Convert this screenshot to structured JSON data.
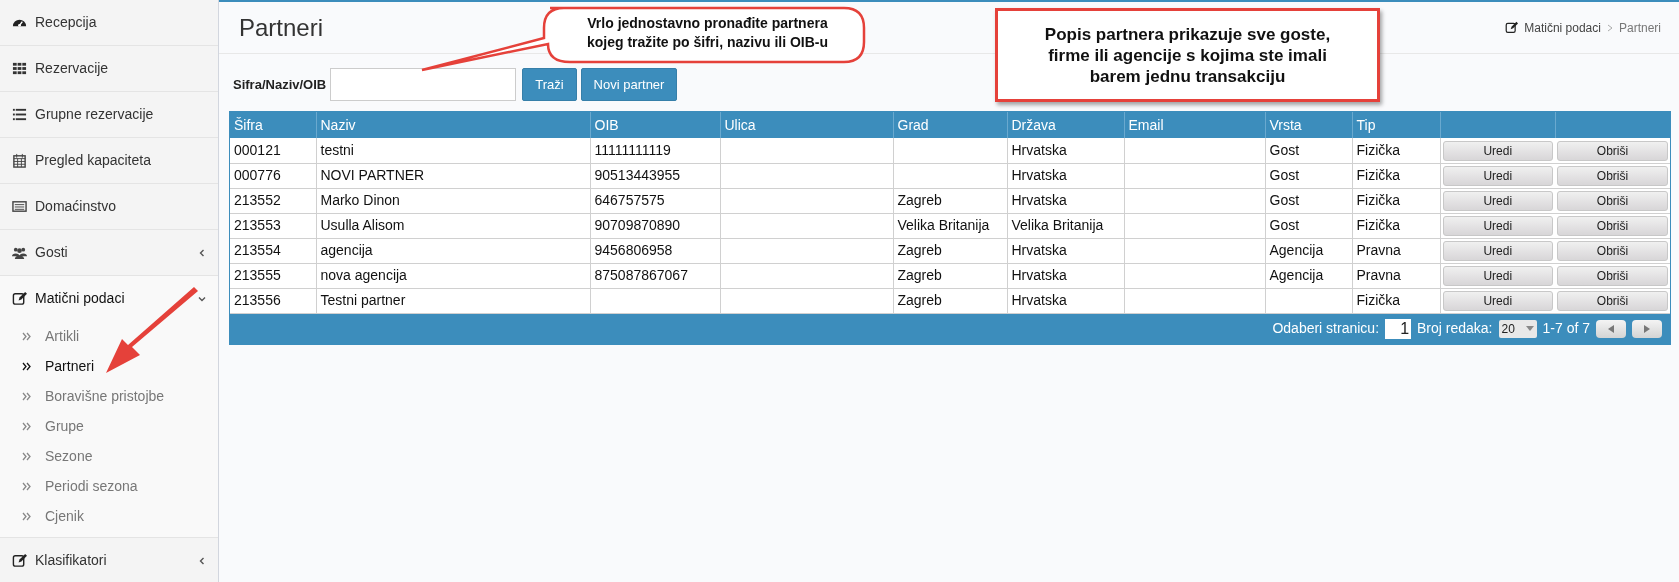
{
  "sidebar": {
    "items": [
      {
        "label": "Recepcija"
      },
      {
        "label": "Rezervacije"
      },
      {
        "label": "Grupne rezervacije"
      },
      {
        "label": "Pregled kapaciteta"
      },
      {
        "label": "Domaćinstvo"
      },
      {
        "label": "Gosti",
        "expanded": false
      },
      {
        "label": "Matični podaci",
        "expanded": true,
        "children": [
          {
            "label": "Artikli",
            "selected": false
          },
          {
            "label": "Partneri",
            "selected": true
          },
          {
            "label": "Boravišne pristojbe",
            "selected": false
          },
          {
            "label": "Grupe",
            "selected": false
          },
          {
            "label": "Sezone",
            "selected": false
          },
          {
            "label": "Periodi sezona",
            "selected": false
          },
          {
            "label": "Cjenik",
            "selected": false
          }
        ]
      },
      {
        "label": "Klasifikatori",
        "expanded": false
      }
    ]
  },
  "header": {
    "title": "Partneri",
    "breadcrumb": [
      "Matični podaci",
      "Partneri"
    ]
  },
  "search": {
    "label": "Sifra/Naziv/OIB",
    "buttons": [
      "Traži",
      "Novi partner"
    ]
  },
  "table": {
    "columns": [
      "Šifra",
      "Naziv",
      "OIB",
      "Ulica",
      "Grad",
      "Država",
      "Email",
      "Vrsta",
      "Tip"
    ],
    "rows": [
      {
        "cells": [
          "000121",
          "testni",
          "11111111119",
          "",
          "",
          "Hrvatska",
          "",
          "Gost",
          "Fizička"
        ],
        "actions": [
          "Uredi",
          "Obriši"
        ]
      },
      {
        "cells": [
          "000776",
          "NOVI PARTNER",
          "90513443955",
          "",
          "",
          "Hrvatska",
          "",
          "Gost",
          "Fizička"
        ],
        "actions": [
          "Uredi",
          "Obriši"
        ]
      },
      {
        "cells": [
          "213552",
          "Marko Dinon",
          "646757575",
          "",
          "Zagreb",
          "Hrvatska",
          "",
          "Gost",
          "Fizička"
        ],
        "actions": [
          "Uredi",
          "Obriši"
        ]
      },
      {
        "cells": [
          "213553",
          "Usulla Alisom",
          "90709870890",
          "",
          "Velika Britanija",
          "Velika Britanija",
          "",
          "Gost",
          "Fizička"
        ],
        "actions": [
          "Uredi",
          "Obriši"
        ]
      },
      {
        "cells": [
          "213554",
          "agencija",
          "9456806958",
          "",
          "Zagreb",
          "Hrvatska",
          "",
          "Agencija",
          "Pravna"
        ],
        "actions": [
          "Uredi",
          "Obriši"
        ]
      },
      {
        "cells": [
          "213555",
          "nova agencija",
          "875087867067",
          "",
          "Zagreb",
          "Hrvatska",
          "",
          "Agencija",
          "Pravna"
        ],
        "actions": [
          "Uredi",
          "Obriši"
        ]
      },
      {
        "cells": [
          "213556",
          "Testni partner",
          "",
          "",
          "Zagreb",
          "Hrvatska",
          "",
          "",
          "Fizička"
        ],
        "actions": [
          "Uredi",
          "Obriši"
        ]
      }
    ],
    "pager": {
      "page_label": "Odaberi stranicu:",
      "page": "1",
      "rows_label": "Broj redaka:",
      "rows": "20",
      "range": "1-7 of 7"
    }
  },
  "annotations": [
    {
      "kind": "bubble",
      "text": "Vrlo jednostavno pronađite partnera kojeg tražite po šifri, nazivu ili OIB-u"
    },
    {
      "kind": "box",
      "text": "Popis partnera prikazuje sve goste, firme ili agencije s kojima ste imali barem jednu transakciju"
    }
  ]
}
